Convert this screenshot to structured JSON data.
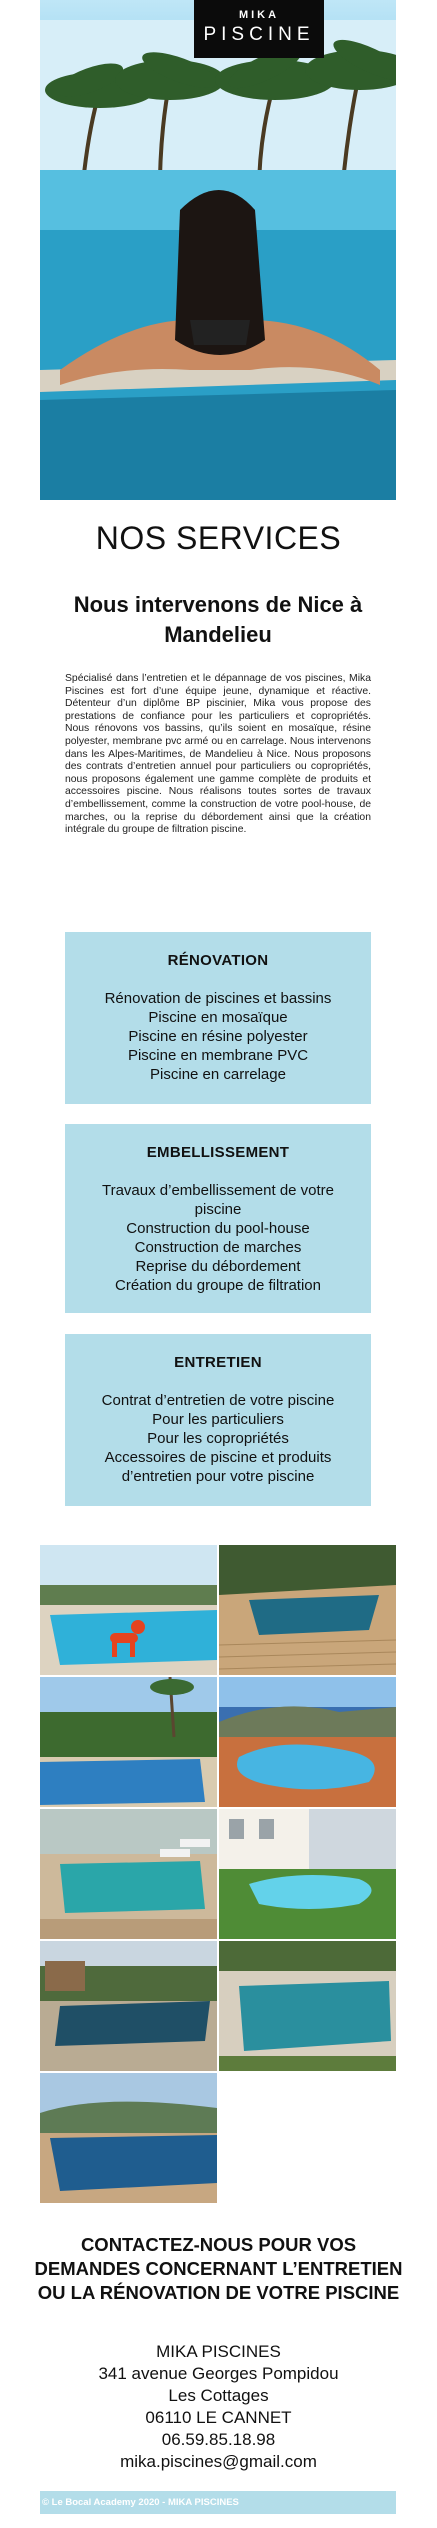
{
  "header": {
    "logo_line1": "MIKA",
    "logo_line2": "PISCINE",
    "menu_icon": "hamburger-menu-icon"
  },
  "hero": {
    "image": "woman-in-pool-with-palm-trees"
  },
  "services": {
    "title": "NOS SERVICES",
    "subtitle": "Nous intervenons de Nice à Mandelieu",
    "intro": "Spécialisé dans l’entretien et le dépannage de vos piscines, Mika Piscines est fort d’une équipe jeune, dynamique et réactive. Détenteur d’un diplôme BP piscinier, Mika vous propose des prestations de confiance pour les particuliers et copropriétés. Nous rénovons vos bassins, qu’ils soient en mosaïque, résine polyester, membrane pvc armé ou en carrelage. Nous intervenons dans les Alpes-Maritimes, de Mandelieu à Nice. Nous proposons des contrats d’entretien annuel pour particuliers ou copropriétés, nous proposons également une gamme complète de produits et accessoires piscine. Nous réalisons toutes sortes de travaux d’embellissement, comme la construction de votre pool-house, de marches, ou la reprise du débordement ainsi que la création intégrale du groupe de filtration piscine."
  },
  "cards": [
    {
      "title": "RÉNOVATION",
      "items": [
        "Rénovation de piscines et bassins",
        "Piscine en mosaïque",
        "Piscine en résine polyester",
        "Piscine en membrane PVC",
        "Piscine en carrelage"
      ]
    },
    {
      "title": "EMBELLISSEMENT",
      "items": [
        "Travaux d’embellissement de votre piscine",
        "Construction du pool-house",
        "Construction de marches",
        "Reprise du débordement",
        "Création du groupe de filtration"
      ]
    },
    {
      "title": "ENTRETIEN",
      "items": [
        "Contrat d’entretien de votre piscine",
        "Pour les particuliers",
        "Pour les copropriétés",
        "Accessoires de piscine et produits d’entretien pour votre piscine"
      ]
    }
  ],
  "gallery": {
    "photos": [
      "pool-with-red-dog-sculpture",
      "pool-with-wooden-deck",
      "pool-with-palm-trees-and-hedges",
      "kidney-shaped-pool-sea-view",
      "pool-with-deck-chairs",
      "freeform-pool-with-lawn",
      "pool-with-pergola",
      "pool-with-stone-terrace",
      "pool-with-mountain-view"
    ]
  },
  "contact": {
    "title": "CONTACTEZ-NOUS POUR VOS DEMANDES CONCERNANT L’ENTRETIEN OU LA RÉNOVATION DE VOTRE PISCINE",
    "company": "MIKA PISCINES",
    "street": "341 avenue Georges Pompidou",
    "district": "Les Cottages",
    "city": "06110 LE CANNET",
    "phone": "06.59.85.18.98",
    "email": "mika.piscines@gmail.com"
  },
  "footer": {
    "text": "© Le Bocal Academy 2020 - MIKA PISCINES"
  },
  "colors": {
    "card_background": "#b3dde9",
    "logo_background": "#0b0b0b",
    "footer_background": "#b3dde9"
  }
}
